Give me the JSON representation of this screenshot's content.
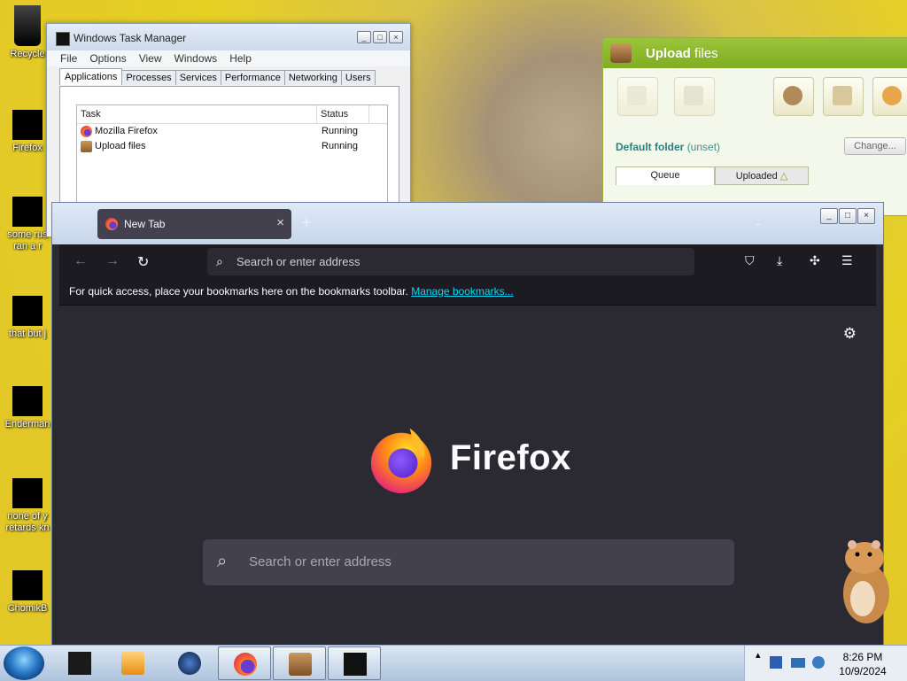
{
  "desktop": {
    "icons": [
      {
        "label": "Recycle"
      },
      {
        "label": "Firefox"
      },
      {
        "label": "some rus",
        "label2": "ran a r"
      },
      {
        "label": "that but j"
      },
      {
        "label": "Enderman"
      },
      {
        "label": "none of y",
        "label2": "retards kn"
      },
      {
        "label": "ChomikB"
      }
    ]
  },
  "task_manager": {
    "title": "Windows Task Manager",
    "menu": [
      "File",
      "Options",
      "View",
      "Windows",
      "Help"
    ],
    "tabs": [
      "Applications",
      "Processes",
      "Services",
      "Performance",
      "Networking",
      "Users"
    ],
    "columns": {
      "task": "Task",
      "status": "Status"
    },
    "rows": [
      {
        "task": "Mozilla Firefox",
        "status": "Running"
      },
      {
        "task": "Upload files",
        "status": "Running"
      }
    ]
  },
  "upload": {
    "title_bold": "Upload",
    "title_rest": " files",
    "folder_label": "Default folder",
    "folder_value": "(unset)",
    "change_button": "Change...",
    "tabs": [
      "Queue",
      "Uploaded"
    ]
  },
  "firefox": {
    "tab_title": "New Tab",
    "url_placeholder": "Search or enter address",
    "bookmarks_text": "For quick access, place your bookmarks here on the bookmarks toolbar.",
    "bookmarks_link": "Manage bookmarks...",
    "logo_text": "Firefox",
    "search_placeholder": "Search or enter address"
  },
  "taskbar": {
    "time": "8:26 PM",
    "date": "10/9/2024"
  },
  "colors": {
    "ff_bg": "#2b2a33",
    "ff_toolbar": "#1c1b22",
    "upload_green": "#8bb82c",
    "link_cyan": "#00ddff"
  }
}
